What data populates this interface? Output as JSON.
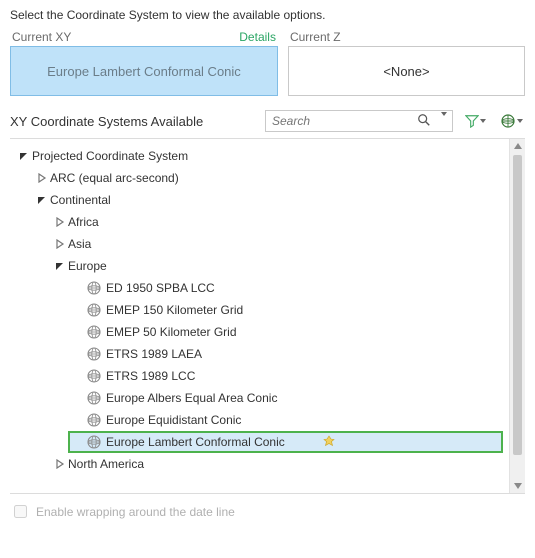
{
  "instruction": "Select the Coordinate System to view the available options.",
  "currentXY": {
    "label": "Current XY",
    "details": "Details",
    "value": "Europe Lambert Conformal Conic"
  },
  "currentZ": {
    "label": "Current Z",
    "value": "<None>"
  },
  "availableTitle": "XY Coordinate Systems Available",
  "search": {
    "placeholder": "Search"
  },
  "tree": {
    "root": "Projected Coordinate System",
    "arc": "ARC (equal arc-second)",
    "continental": "Continental",
    "africa": "Africa",
    "asia": "Asia",
    "europe": "Europe",
    "leaves": [
      "ED 1950 SPBA LCC",
      "EMEP 150 Kilometer Grid",
      "EMEP 50 Kilometer Grid",
      "ETRS 1989 LAEA",
      "ETRS 1989 LCC",
      "Europe Albers Equal Area Conic",
      "Europe Equidistant Conic",
      "Europe Lambert Conformal Conic"
    ],
    "northAmerica": "North America"
  },
  "footer": {
    "wrapLabel": "Enable wrapping around the date line"
  },
  "icons": {
    "filter": "filter-icon",
    "globeTool": "globe-tool-icon"
  }
}
